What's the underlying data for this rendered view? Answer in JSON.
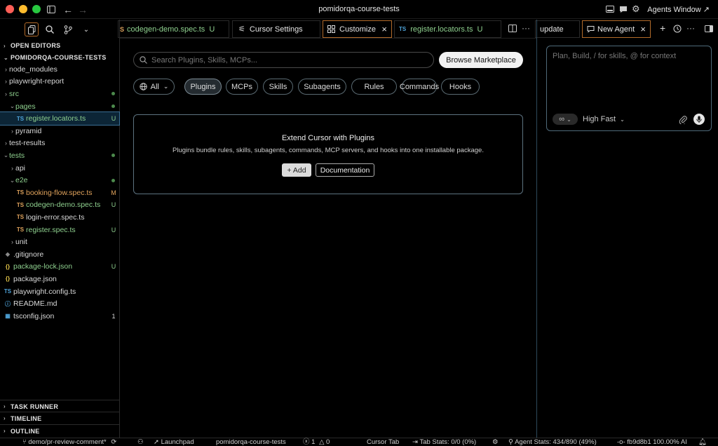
{
  "window": {
    "title": "pomidorqa-course-tests",
    "agents_window_label": "Agents Window ↗"
  },
  "sidebar": {
    "open_editors_label": "OPEN EDITORS",
    "project_label": "POMIDORQA-COURSE-TESTS",
    "tree": [
      {
        "label": "node_modules",
        "kind": "folder",
        "state": "closed",
        "depth": 1
      },
      {
        "label": "playwright-report",
        "kind": "folder",
        "state": "closed",
        "depth": 1
      },
      {
        "label": "src",
        "kind": "folder",
        "state": "closed",
        "depth": 1,
        "color": "green",
        "marker": "dot"
      },
      {
        "label": "pages",
        "kind": "folder",
        "state": "open",
        "depth": 2,
        "color": "green",
        "marker": "dot"
      },
      {
        "label": "register.locators.ts",
        "kind": "file",
        "icon": "TS",
        "depth": 3,
        "color": "green",
        "badge": "U",
        "selected": true
      },
      {
        "label": "pyramid",
        "kind": "folder",
        "state": "closed",
        "depth": 2
      },
      {
        "label": "test-results",
        "kind": "folder",
        "state": "closed",
        "depth": 1
      },
      {
        "label": "tests",
        "kind": "folder",
        "state": "open",
        "depth": 1,
        "color": "green",
        "marker": "dot"
      },
      {
        "label": "api",
        "kind": "folder",
        "state": "closed",
        "depth": 2
      },
      {
        "label": "e2e",
        "kind": "folder",
        "state": "open",
        "depth": 2,
        "color": "green",
        "marker": "dot"
      },
      {
        "label": "booking-flow.spec.ts",
        "kind": "file",
        "icon": "TS",
        "depth": 3,
        "color": "orange",
        "badge": "M"
      },
      {
        "label": "codegen-demo.spec.ts",
        "kind": "file",
        "icon": "TS",
        "depth": 3,
        "color": "green",
        "badge": "U"
      },
      {
        "label": "login-error.spec.ts",
        "kind": "file",
        "icon": "TS",
        "depth": 3
      },
      {
        "label": "register.spec.ts",
        "kind": "file",
        "icon": "TS",
        "depth": 3,
        "color": "green",
        "badge": "U"
      },
      {
        "label": "unit",
        "kind": "folder",
        "state": "closed",
        "depth": 2
      },
      {
        "label": ".gitignore",
        "kind": "file",
        "icon": "◆",
        "depth": 1
      },
      {
        "label": "package-lock.json",
        "kind": "file",
        "icon": "{}",
        "depth": 1,
        "color": "green",
        "badge": "U"
      },
      {
        "label": "package.json",
        "kind": "file",
        "icon": "{}",
        "depth": 1
      },
      {
        "label": "playwright.config.ts",
        "kind": "file",
        "icon": "TS",
        "depth": 1
      },
      {
        "label": "README.md",
        "kind": "file",
        "icon": "ⓘ",
        "depth": 1
      },
      {
        "label": "tsconfig.json",
        "kind": "file",
        "icon": "▦",
        "depth": 1,
        "badge": "1"
      }
    ],
    "bottom_sections": [
      "TASK RUNNER",
      "TIMELINE",
      "OUTLINE"
    ]
  },
  "tabs": [
    {
      "label": "codegen-demo.spec.ts",
      "icon": "S",
      "suffix": "U",
      "color": "green"
    },
    {
      "label": "Cursor Settings",
      "icon": "settings"
    },
    {
      "label": "Customize",
      "icon": "customize",
      "active": true,
      "closable": true
    },
    {
      "label": "register.locators.ts",
      "icon": "TS",
      "suffix": "U",
      "color": "green"
    }
  ],
  "right_tabs": [
    {
      "label": "update"
    },
    {
      "label": "New Agent",
      "active": true,
      "closable": true
    }
  ],
  "main": {
    "search_placeholder": "Search Plugins, Skills, MCPs...",
    "browse_label": "Browse Marketplace",
    "filter_all": "All",
    "filters": [
      "Plugins",
      "MCPs",
      "Skills",
      "Subagents",
      "Rules",
      "Commands",
      "Hooks"
    ],
    "active_filter": "Plugins",
    "card": {
      "title": "Extend Cursor with Plugins",
      "description": "Plugins bundle rules, skills, subagents, commands, MCP servers, and hooks into one installable package.",
      "add_label": "+ Add",
      "docs_label": "Documentation"
    }
  },
  "agent": {
    "placeholder": "Plan, Build, / for skills, @ for context",
    "mode_label": "∞",
    "model_label": "High Fast"
  },
  "statusbar": {
    "branch": "demo/pr-review-comment*",
    "launchpad": "Launchpad",
    "project": "pomidorqa-course-tests",
    "errors": "1",
    "warnings": "0",
    "cursor_tab": "Cursor Tab",
    "tab_stats": "Tab Stats: 0/0 (0%)",
    "agent_stats": "Agent Stats: 434/890 (49%)",
    "commit": "fb9d8b1 100.00% AI"
  },
  "colors": {
    "accent_orange": "#b36b2a",
    "git_added": "#8fd18f",
    "git_modified": "#e0a35c",
    "selection": "#0c2536"
  }
}
